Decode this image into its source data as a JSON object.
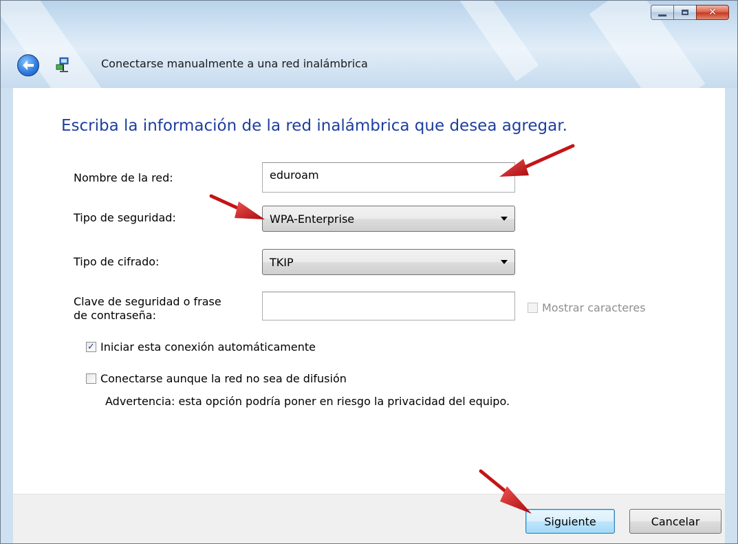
{
  "window": {
    "title": "Conectarse manualmente a una red inalámbrica"
  },
  "page": {
    "heading": "Escriba la información de la red inalámbrica que desea agregar."
  },
  "form": {
    "network_name_label": "Nombre de la red:",
    "network_name_value": "eduroam",
    "security_type_label": "Tipo de seguridad:",
    "security_type_value": "WPA-Enterprise",
    "encryption_type_label": "Tipo de cifrado:",
    "encryption_type_value": "TKIP",
    "security_key_label_line1": "Clave de seguridad o frase",
    "security_key_label_line2": "de contraseña:",
    "security_key_value": "",
    "show_chars_label": "Mostrar caracteres",
    "auto_connect_label": "Iniciar esta conexión automáticamente",
    "auto_connect_checked": true,
    "nonbroadcast_label": "Conectarse aunque la red no sea de difusión",
    "nonbroadcast_checked": false,
    "warning_text": "Advertencia: esta opción podría poner en riesgo la privacidad del equipo."
  },
  "footer": {
    "next_label": "Siguiente",
    "cancel_label": "Cancelar"
  },
  "icons": {
    "back": "back-arrow-icon",
    "network": "network-icon",
    "minimize": "minimize-icon",
    "maximize": "maximize-icon",
    "close": "close-icon",
    "dropdown": "chevron-down-icon",
    "check": "checkmark-icon"
  },
  "colors": {
    "heading": "#1e3ea0",
    "annotation_arrow": "#d0141a",
    "close_button": "#c6391f"
  }
}
